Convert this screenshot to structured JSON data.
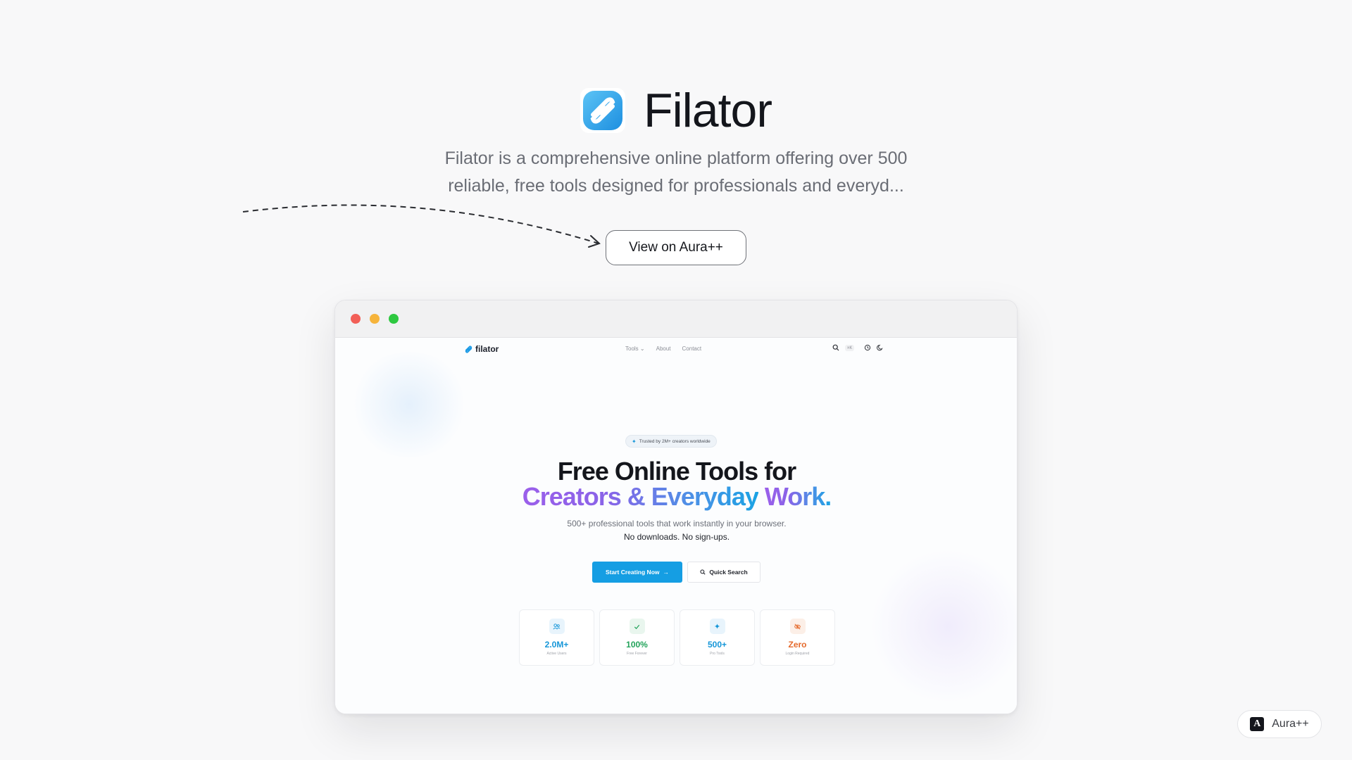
{
  "showcase": {
    "title": "Filator",
    "description_line1": "Filator is a comprehensive online platform offering over 500",
    "description_line2": "reliable, free tools designed for professionals and everyd...",
    "view_button": "View on Aura++"
  },
  "browser": {
    "site": {
      "logo_text": "filator",
      "nav": [
        "Tools",
        "About",
        "Contact"
      ],
      "search_shortcut": "⌘K",
      "trust_pill": "Trusted by 2M+ creators worldwide",
      "headline_line1": "Free Online Tools for",
      "headline_line2_part1": "Creators & Everyday",
      "headline_line2_part2": "Work.",
      "subtitle_line1": "500+ professional tools that work instantly in your browser.",
      "subtitle_line2": "No downloads. No sign-ups.",
      "cta_primary": "Start Creating Now",
      "cta_secondary": "Quick Search",
      "stats": [
        {
          "value": "2.0M+",
          "label": "Active Users",
          "color": "#1596d8",
          "icon": "users-icon"
        },
        {
          "value": "100%",
          "label": "Free Forever",
          "color": "#22a35a",
          "icon": "check-icon"
        },
        {
          "value": "500+",
          "label": "Pro Tools",
          "color": "#1596d8",
          "icon": "sparkle-icon"
        },
        {
          "value": "Zero",
          "label": "Login Required",
          "color": "#e56a2c",
          "icon": "eye-off-icon"
        }
      ]
    }
  },
  "badge": {
    "mark": "A",
    "label": "Aura++"
  },
  "colors": {
    "primary": "#159ee3",
    "gradient_start": "#9b5fea",
    "gradient_end": "#1aa3e4"
  }
}
